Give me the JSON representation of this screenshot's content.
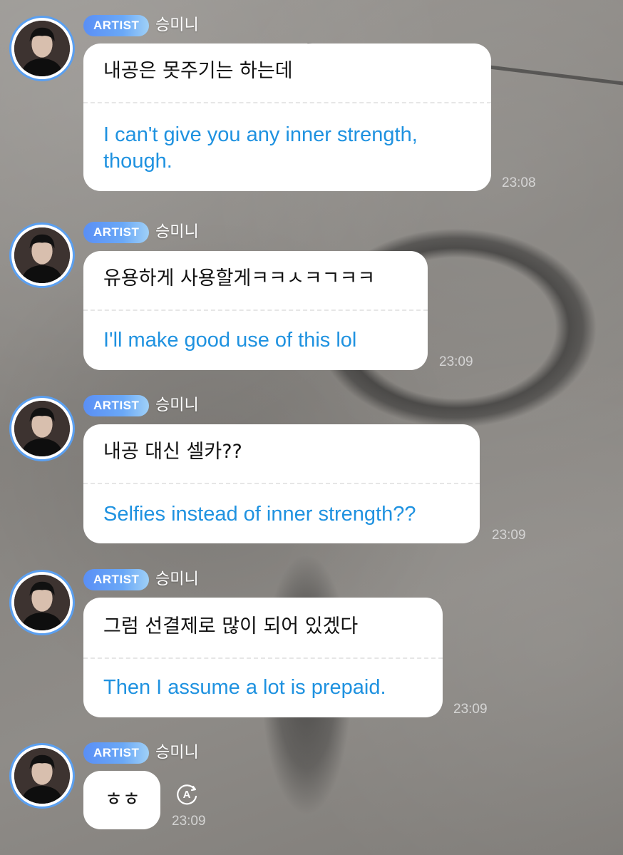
{
  "messages": [
    {
      "badge": "ARTIST",
      "username": "승미니",
      "korean": "내공은 못주기는 하는데",
      "english": "I can't give you any inner strength, though.",
      "time": "23:08"
    },
    {
      "badge": "ARTIST",
      "username": "승미니",
      "korean": "유용하게 사용할게ㅋㅋㅅㅋㄱㅋㅋ",
      "english": "I'll make good use of this lol",
      "time": "23:09"
    },
    {
      "badge": "ARTIST",
      "username": "승미니",
      "korean": "내공 대신 셀카??",
      "english": "Selfies instead of inner strength??",
      "time": "23:09"
    },
    {
      "badge": "ARTIST",
      "username": "승미니",
      "korean": "그럼 선결제로 많이 되어 있겠다",
      "english": "Then I assume a lot is prepaid.",
      "time": "23:09"
    },
    {
      "badge": "ARTIST",
      "username": "승미니",
      "korean": "ㅎㅎ",
      "time": "23:09",
      "translate_icon_letter": "A"
    }
  ],
  "icons": {
    "avatar": "profile-photo",
    "translate": "translate-icon"
  },
  "colors": {
    "badge_start": "#5a8ff5",
    "badge_end": "#9fd0f7",
    "translation_text": "#1f92e0",
    "avatar_ring": "#5a9ff0",
    "bubble": "#ffffff"
  }
}
